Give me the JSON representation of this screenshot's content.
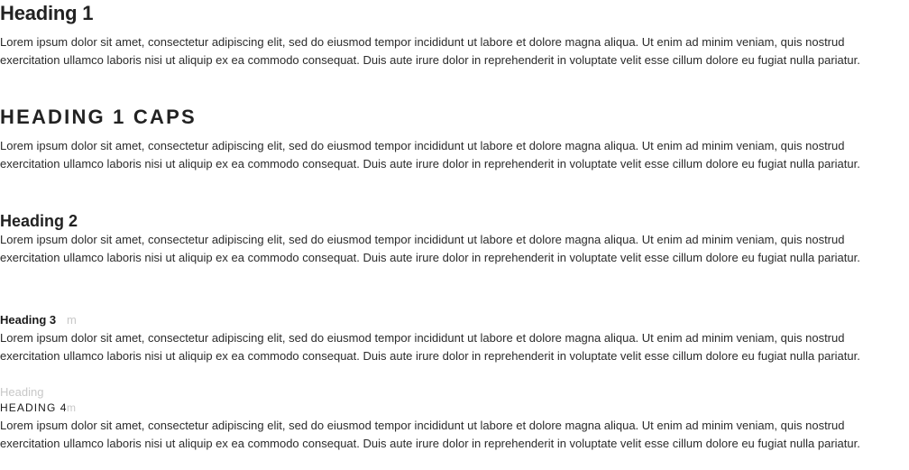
{
  "document": {
    "heading1": "Heading 1",
    "heading1_caps": "HEADING 1 CAPS",
    "heading2": "Heading 2",
    "heading3": "Heading 3",
    "heading3_ghost_suffix": "m",
    "heading4_ghost_top": "Heading",
    "heading4": "HEADING 4",
    "heading4_ghost_suffix": "m",
    "paragraphs": [
      "Lorem ipsum dolor sit amet, consectetur adipiscing elit, sed do eiusmod tempor incididunt ut labore et dolore magna aliqua. Ut enim ad minim veniam, quis nostrud exercitation ullamco laboris nisi ut aliquip ex ea commodo consequat. Duis aute irure dolor in reprehenderit in voluptate velit esse cillum dolore eu fugiat nulla pariatur.",
      "Lorem ipsum dolor sit amet, consectetur adipiscing elit, sed do eiusmod tempor incididunt ut labore et dolore magna aliqua. Ut enim ad minim veniam, quis nostrud exercitation ullamco laboris nisi ut aliquip ex ea commodo consequat. Duis aute irure dolor in reprehenderit in voluptate velit esse cillum dolore eu fugiat nulla pariatur.",
      "Lorem ipsum dolor sit amet, consectetur adipiscing elit, sed do eiusmod tempor incididunt ut labore et dolore magna aliqua. Ut enim ad minim veniam, quis nostrud exercitation ullamco laboris nisi ut aliquip ex ea commodo consequat. Duis aute irure dolor in reprehenderit in voluptate velit esse cillum dolore eu fugiat nulla pariatur.",
      "Lorem ipsum dolor sit amet, consectetur adipiscing elit, sed do eiusmod tempor incididunt ut labore et dolore magna aliqua. Ut enim ad minim veniam, quis nostrud exercitation ullamco laboris nisi ut aliquip ex ea commodo consequat. Duis aute irure dolor in reprehenderit in voluptate velit esse cillum dolore eu fugiat nulla pariatur.",
      "Lorem ipsum dolor sit amet, consectetur adipiscing elit, sed do eiusmod tempor incididunt ut labore et dolore magna aliqua. Ut enim ad minim veniam, quis nostrud exercitation ullamco laboris nisi ut aliquip ex ea commodo consequat. Duis aute irure dolor in reprehenderit in voluptate velit esse cillum dolore eu fugiat nulla pariatur."
    ]
  },
  "colors": {
    "text": "#2b2b2b",
    "heading": "#222222",
    "ghost": "#c8c8c8",
    "background": "#ffffff"
  }
}
